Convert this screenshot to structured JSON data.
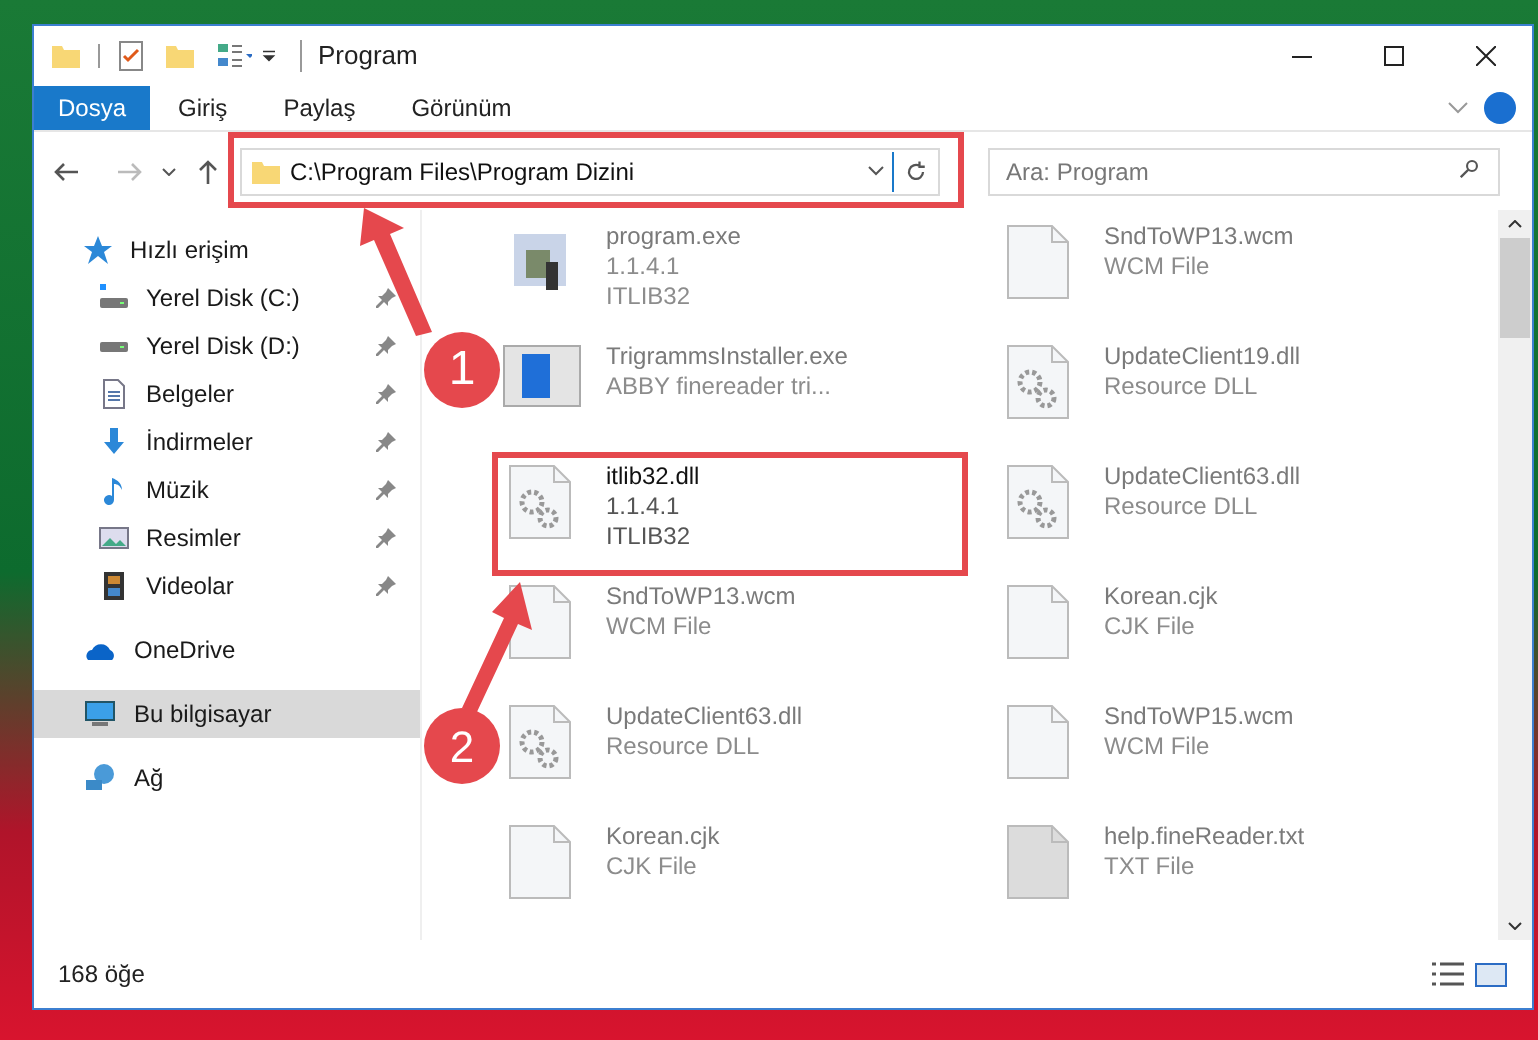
{
  "window": {
    "title": "Program"
  },
  "ribbon_tabs": [
    {
      "label": "Dosya",
      "kind": "file"
    },
    {
      "label": "Giriş",
      "kind": "tab"
    },
    {
      "label": "Paylaş",
      "kind": "tab"
    },
    {
      "label": "Görünüm",
      "kind": "tab"
    }
  ],
  "address_bar": {
    "path": "C:\\Program Files\\Program Dizini"
  },
  "search": {
    "placeholder": "Ara: Program"
  },
  "sidebar": {
    "items": [
      {
        "label": "Hızlı erişim",
        "kind": "star",
        "selected": false,
        "children": [
          {
            "label": "Yerel Disk (C:)",
            "kind": "drive-c",
            "pinned": true
          },
          {
            "label": "Yerel Disk (D:)",
            "kind": "drive",
            "pinned": true
          },
          {
            "label": "Belgeler",
            "kind": "docs",
            "pinned": true
          },
          {
            "label": "İndirmeler",
            "kind": "download",
            "pinned": true
          },
          {
            "label": "Müzik",
            "kind": "music",
            "pinned": true
          },
          {
            "label": "Resimler",
            "kind": "pictures",
            "pinned": true
          },
          {
            "label": "Videolar",
            "kind": "video",
            "pinned": true
          }
        ]
      },
      {
        "label": "OneDrive",
        "kind": "cloud",
        "selected": false
      },
      {
        "label": "Bu bilgisayar",
        "kind": "pc",
        "selected": true
      },
      {
        "label": "Ağ",
        "kind": "network",
        "selected": false
      }
    ]
  },
  "files": [
    {
      "name": "program.exe",
      "details": [
        "1.1.4.1",
        "ITLIB32"
      ],
      "kind": "program",
      "blurred": true
    },
    {
      "name": "SndToWP13.wcm",
      "details": [
        "WCM File"
      ],
      "kind": "file",
      "blurred": true
    },
    {
      "name": "TrigrammsInstaller.exe",
      "details": [
        "ABBY finereader tri..."
      ],
      "kind": "installer",
      "blurred": true
    },
    {
      "name": "UpdateClient19.dll",
      "details": [
        "Resource DLL"
      ],
      "kind": "dll",
      "blurred": true
    },
    {
      "name": "itlib32.dll",
      "details": [
        "1.1.4.1",
        "ITLIB32"
      ],
      "kind": "dll",
      "blurred": false
    },
    {
      "name": "UpdateClient63.dll",
      "details": [
        "Resource DLL"
      ],
      "kind": "dll",
      "blurred": true
    },
    {
      "name": "SndToWP13.wcm",
      "details": [
        "WCM File"
      ],
      "kind": "file",
      "blurred": true
    },
    {
      "name": "Korean.cjk",
      "details": [
        "CJK File"
      ],
      "kind": "file",
      "blurred": true
    },
    {
      "name": "UpdateClient63.dll",
      "details": [
        "Resource DLL"
      ],
      "kind": "dll",
      "blurred": true
    },
    {
      "name": "SndToWP15.wcm",
      "details": [
        "WCM File"
      ],
      "kind": "file",
      "blurred": true
    },
    {
      "name": "Korean.cjk",
      "details": [
        "CJK File"
      ],
      "kind": "file",
      "blurred": true
    },
    {
      "name": "help.fineReader.txt",
      "details": [
        "TXT File"
      ],
      "kind": "text",
      "blurred": true
    }
  ],
  "annotations": [
    {
      "number": "1"
    },
    {
      "number": "2"
    }
  ],
  "status_bar": {
    "count": "168 öğe"
  }
}
